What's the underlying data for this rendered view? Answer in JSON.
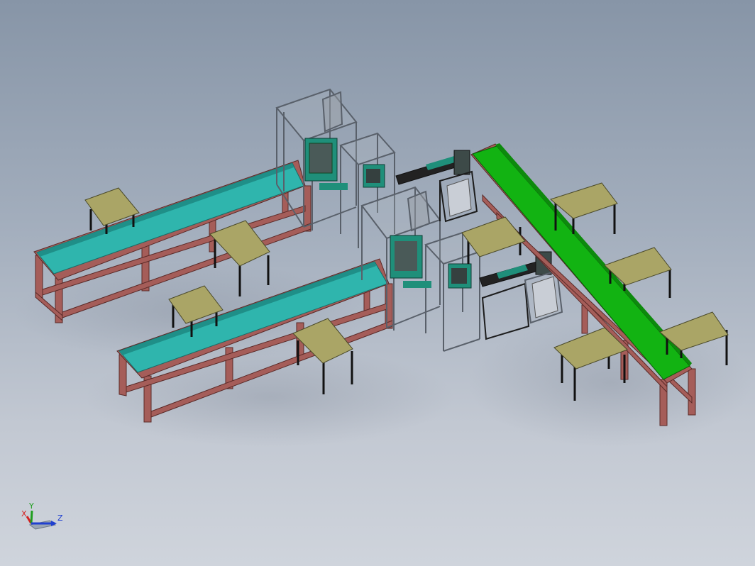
{
  "viewport": {
    "background_top": "#8795a7",
    "background_bottom": "#cfd4dc"
  },
  "model": {
    "teal_conveyor_color": "#2fb5ad",
    "green_conveyor_color": "#12b312",
    "frame_color": "#a55d59",
    "table_top_color": "#aaa566",
    "table_leg_color": "#1c1c1c",
    "enclosure_color": "#9aa0a8",
    "machine_color": "#1f8f7a"
  },
  "triad": {
    "x_label": "X",
    "y_label": "Y",
    "z_label": "Z",
    "x_color": "#d42020",
    "y_color": "#1f9e1f",
    "z_color": "#2040d0"
  }
}
